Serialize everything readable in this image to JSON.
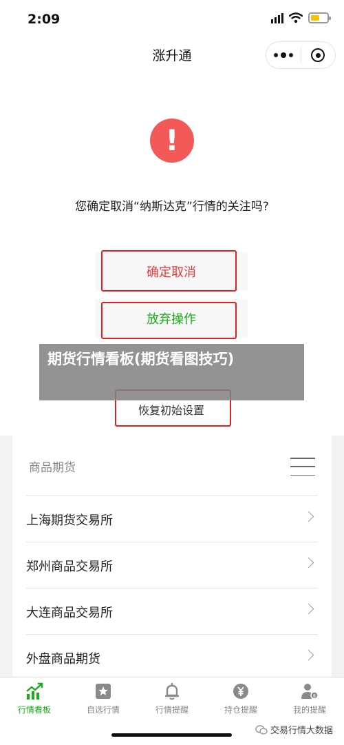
{
  "status_bar": {
    "time": "2:09"
  },
  "header": {
    "title": "涨升通"
  },
  "dialog": {
    "alert_glyph": "!",
    "question": "您确定取消“纳斯达克”行情的关注吗?",
    "confirm_label": "确定取消",
    "abort_label": "放弃操作",
    "reset_label": "恢复初始设置"
  },
  "banner": {
    "text": "期货行情看板(期货看图技巧)"
  },
  "futures_card": {
    "header": "商品期货",
    "items": [
      {
        "label": "上海期货交易所"
      },
      {
        "label": "郑州商品交易所"
      },
      {
        "label": "大连商品交易所"
      },
      {
        "label": "外盘商品期货"
      }
    ]
  },
  "tabbar": {
    "tabs": [
      {
        "label": "行情看板",
        "icon": "chart-up-icon",
        "active": true
      },
      {
        "label": "自选行情",
        "icon": "star-icon",
        "active": false
      },
      {
        "label": "行情提醒",
        "icon": "bell-icon",
        "active": false
      },
      {
        "label": "持仓提醒",
        "icon": "yen-coin-icon",
        "active": false
      },
      {
        "label": "我的提醒",
        "icon": "user-money-icon",
        "active": false
      }
    ]
  },
  "watermark": {
    "text": "交易行情大数据"
  },
  "colors": {
    "danger": "#e4393c",
    "success": "#1aad19",
    "alert_circle": "#f25a5a",
    "highlight_outline": "#e02020"
  }
}
